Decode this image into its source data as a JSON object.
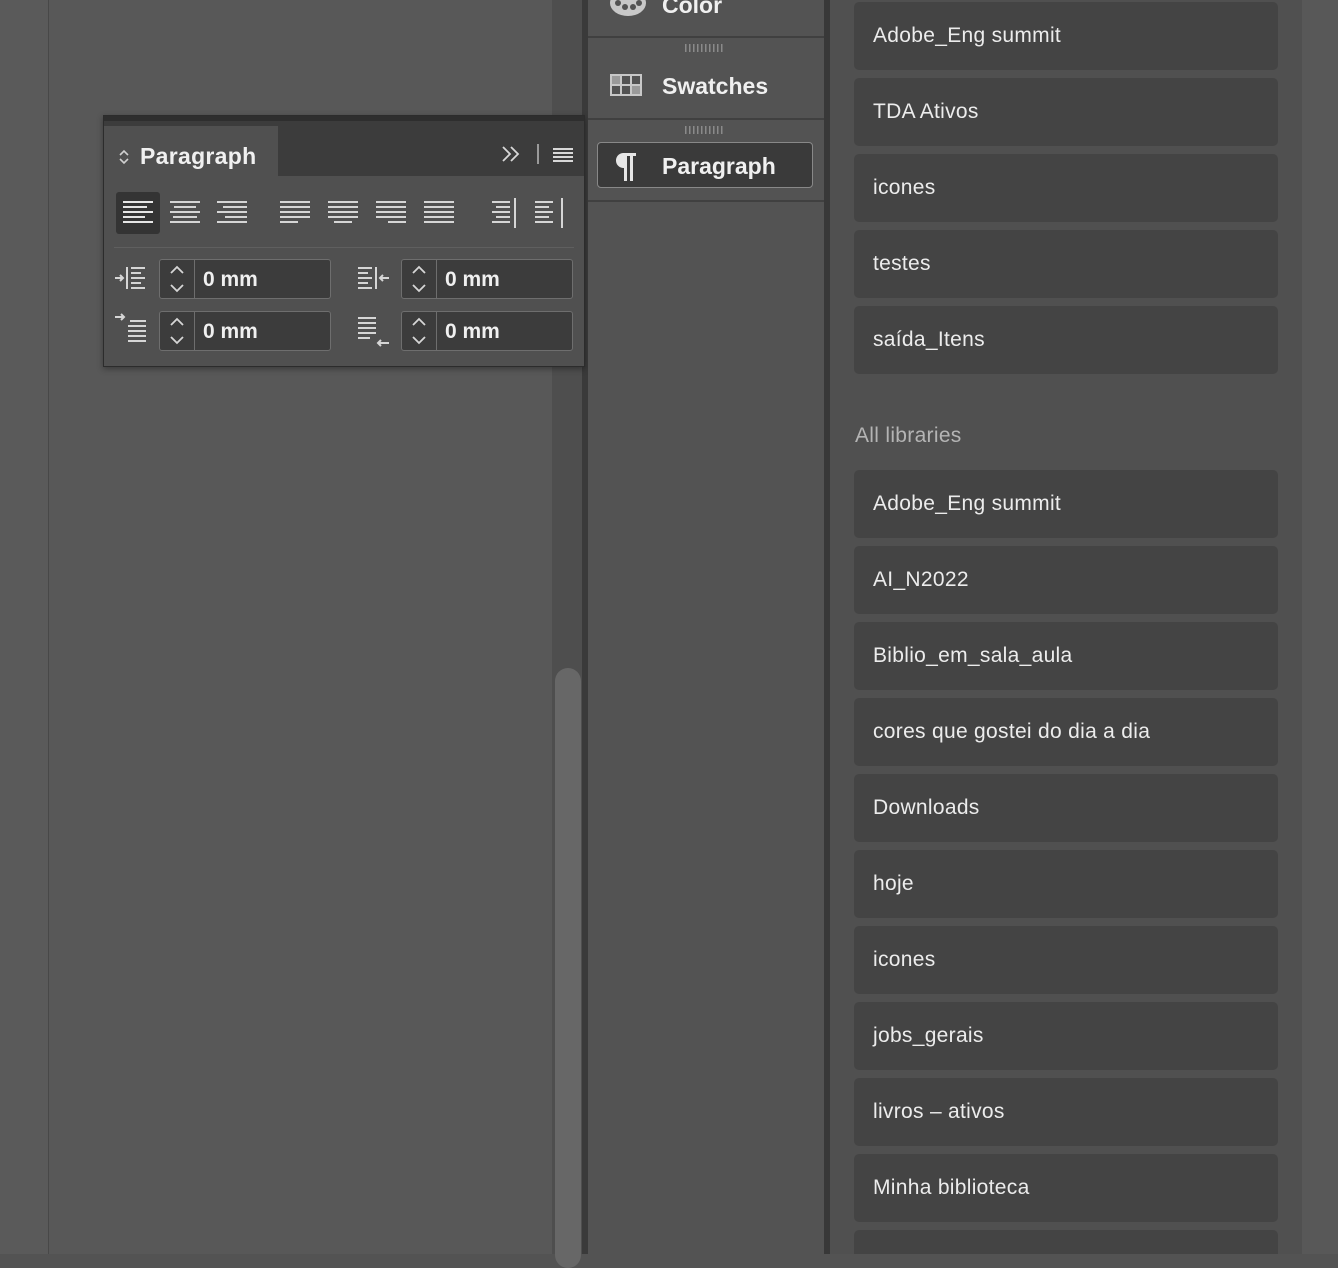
{
  "paragraph_panel": {
    "title": "Paragraph",
    "indents": {
      "left_indent": "0 mm",
      "right_indent": "0 mm",
      "first_line_indent": "0 mm",
      "last_line_indent": "0 mm"
    }
  },
  "dock": {
    "color_label": "Color",
    "swatches_label": "Swatches",
    "paragraph_label": "Paragraph"
  },
  "libraries": {
    "recent": [
      "Adobe_Eng summit",
      "TDA Ativos",
      "icones",
      "testes",
      "saída_Itens"
    ],
    "all_heading": "All libraries",
    "all": [
      "Adobe_Eng summit",
      "AI_N2022",
      "Biblio_em_sala_aula",
      "cores que gostei do dia a dia",
      "Downloads",
      "hoje",
      "icones",
      "jobs_gerais",
      "livros – ativos",
      "Minha biblioteca"
    ]
  }
}
